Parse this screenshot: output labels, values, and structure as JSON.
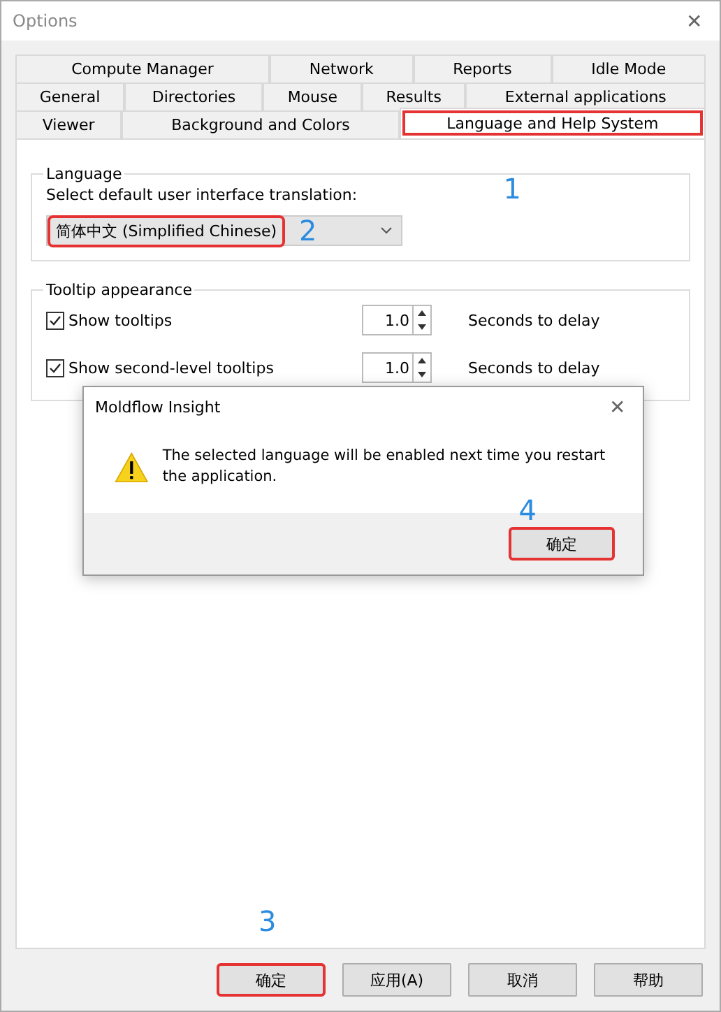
{
  "window": {
    "title": "Options",
    "close": "✕"
  },
  "tab_rows": [
    [
      {
        "label": "Compute Manager",
        "selected": false,
        "highlighted": false
      },
      {
        "label": "Network",
        "selected": false,
        "highlighted": false
      },
      {
        "label": "Reports",
        "selected": false,
        "highlighted": false
      },
      {
        "label": "Idle Mode",
        "selected": false,
        "highlighted": false
      }
    ],
    [
      {
        "label": "General",
        "selected": false,
        "highlighted": false
      },
      {
        "label": "Directories",
        "selected": false,
        "highlighted": false
      },
      {
        "label": "Mouse",
        "selected": false,
        "highlighted": false
      },
      {
        "label": "Results",
        "selected": false,
        "highlighted": false
      },
      {
        "label": "External applications",
        "selected": false,
        "highlighted": false
      }
    ],
    [
      {
        "label": "Viewer",
        "selected": false,
        "highlighted": false
      },
      {
        "label": "Background and Colors",
        "selected": false,
        "highlighted": false
      },
      {
        "label": "Language and Help System",
        "selected": true,
        "highlighted": true
      }
    ]
  ],
  "language_group": {
    "title": "Language",
    "marker": "1",
    "prompt": "Select default user interface translation:",
    "dropdown": {
      "value": "简体中文 (Simplified Chinese)",
      "highlighted": true,
      "marker": "2"
    }
  },
  "tooltip_group": {
    "title": "Tooltip appearance",
    "rows": [
      {
        "label": "Show tooltips",
        "checked": true,
        "value": "1.0",
        "unit": "Seconds to delay"
      },
      {
        "label": "Show second-level tooltips",
        "checked": true,
        "value": "1.0",
        "unit": "Seconds to delay"
      }
    ]
  },
  "message_dialog": {
    "title": "Moldflow Insight",
    "close": "✕",
    "message": "The selected language will be enabled next time you restart the application.",
    "button": {
      "label": "确定",
      "highlighted": true,
      "marker": "4"
    }
  },
  "footer_buttons": [
    {
      "label": "确定",
      "highlighted": true,
      "marker": "3"
    },
    {
      "label": "应用(A)",
      "highlighted": false
    },
    {
      "label": "取消",
      "highlighted": false
    },
    {
      "label": "帮助",
      "highlighted": false
    }
  ]
}
